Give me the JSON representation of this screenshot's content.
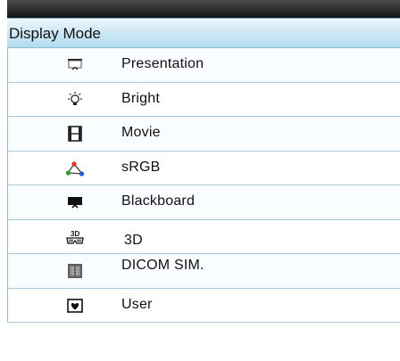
{
  "menu": {
    "title": "Display Mode",
    "items": [
      {
        "label": "Presentation",
        "icon": "presentation-screen-icon"
      },
      {
        "label": "Bright",
        "icon": "bright-bulb-icon"
      },
      {
        "label": "Movie",
        "icon": "film-strip-icon"
      },
      {
        "label": "sRGB",
        "icon": "srgb-triangle-icon"
      },
      {
        "label": "Blackboard",
        "icon": "blackboard-icon"
      },
      {
        "label": "3D",
        "icon": "3d-glasses-icon"
      },
      {
        "label": "DICOM SIM.",
        "icon": "xray-icon"
      },
      {
        "label": "User",
        "icon": "heart-icon"
      }
    ]
  },
  "colors": {
    "header_gradient_top": "#eef8fd",
    "header_gradient_bottom": "#b4dbef",
    "row_divider": "#a9c8da",
    "top_bar": "#1e1e1e",
    "srgb_red": "#e0301e",
    "srgb_green": "#2a9d2a",
    "srgb_blue": "#1e5bd6"
  }
}
